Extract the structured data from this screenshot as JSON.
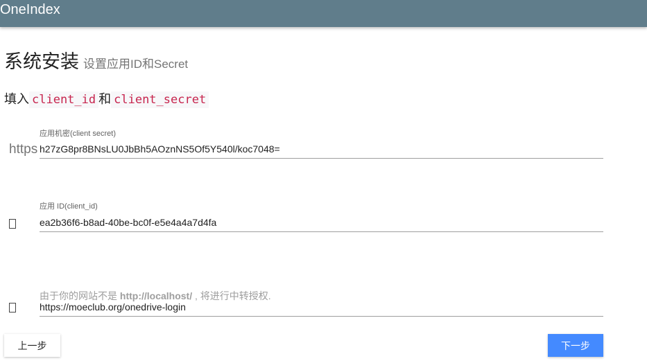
{
  "header": {
    "brand": "OneIndex"
  },
  "page": {
    "title": "系统安装",
    "subtitle": "设置应用ID和Secret"
  },
  "instruction": {
    "prefix": "填入",
    "code_client_id": "client_id",
    "conjunction": "和",
    "code_client_secret": "client_secret"
  },
  "form": {
    "client_secret": {
      "label": "应用机密(client secret)",
      "value": "h27zG8pr8BNsLU0JbBh5AOznNS5Of5Y540l/koc7048=",
      "icon_text": "https"
    },
    "client_id": {
      "label": "应用 ID(client_id)",
      "value": "ea2b36f6-b8ad-40be-bc0f-e5e4a4a7d4fa"
    },
    "redirect": {
      "hint_prefix": "由于你的网站不是 ",
      "hint_host": "http://localhost/",
      "hint_suffix": " , 将进行中转授权.",
      "value": "https://moeclub.org/onedrive-login"
    }
  },
  "buttons": {
    "prev": "上一步",
    "next": "下一步"
  },
  "colors": {
    "topbar": "#607d8b",
    "primary": "#448aff",
    "code": "#c7254e"
  }
}
